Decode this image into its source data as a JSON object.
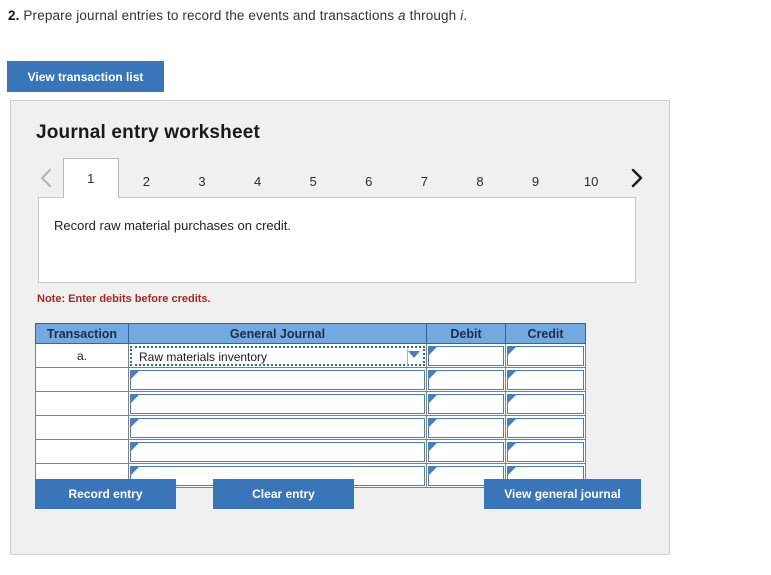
{
  "question": {
    "number": "2.",
    "text_before": "Prepare journal entries to record the events and transactions",
    "italic_a": "a",
    "text_mid": "through",
    "italic_i": "i",
    "text_after": "."
  },
  "toolbar": {
    "view_transaction_list_label": "View transaction list"
  },
  "worksheet": {
    "title": "Journal entry worksheet",
    "prev_icon": "chevron-left-icon",
    "next_icon": "chevron-right-icon",
    "tabs": [
      {
        "label": "1",
        "active": true
      },
      {
        "label": "2",
        "active": false
      },
      {
        "label": "3",
        "active": false
      },
      {
        "label": "4",
        "active": false
      },
      {
        "label": "5",
        "active": false
      },
      {
        "label": "6",
        "active": false
      },
      {
        "label": "7",
        "active": false
      },
      {
        "label": "8",
        "active": false
      },
      {
        "label": "9",
        "active": false
      },
      {
        "label": "10",
        "active": false
      }
    ],
    "instruction": "Record raw material purchases on credit.",
    "note": "Note: Enter debits before credits.",
    "table": {
      "headers": [
        "Transaction",
        "General Journal",
        "Debit",
        "Credit"
      ],
      "rows": [
        {
          "transaction": "a.",
          "account": "Raw materials inventory",
          "selected": true,
          "debit": "",
          "credit": ""
        },
        {
          "transaction": "",
          "account": "",
          "selected": false,
          "debit": "",
          "credit": ""
        },
        {
          "transaction": "",
          "account": "",
          "selected": false,
          "debit": "",
          "credit": ""
        },
        {
          "transaction": "",
          "account": "",
          "selected": false,
          "debit": "",
          "credit": ""
        },
        {
          "transaction": "",
          "account": "",
          "selected": false,
          "debit": "",
          "credit": ""
        },
        {
          "transaction": "",
          "account": "",
          "selected": false,
          "debit": "",
          "credit": ""
        }
      ]
    },
    "actions": {
      "record_entry_label": "Record entry",
      "clear_entry_label": "Clear entry",
      "view_general_journal_label": "View general journal"
    }
  },
  "colors": {
    "button_blue": "#3a75ba",
    "table_header_blue": "#74a9e0",
    "note_red": "#9e2a2a",
    "panel_gray": "#f0f0f0",
    "field_border_blue": "#4a7fb5"
  }
}
